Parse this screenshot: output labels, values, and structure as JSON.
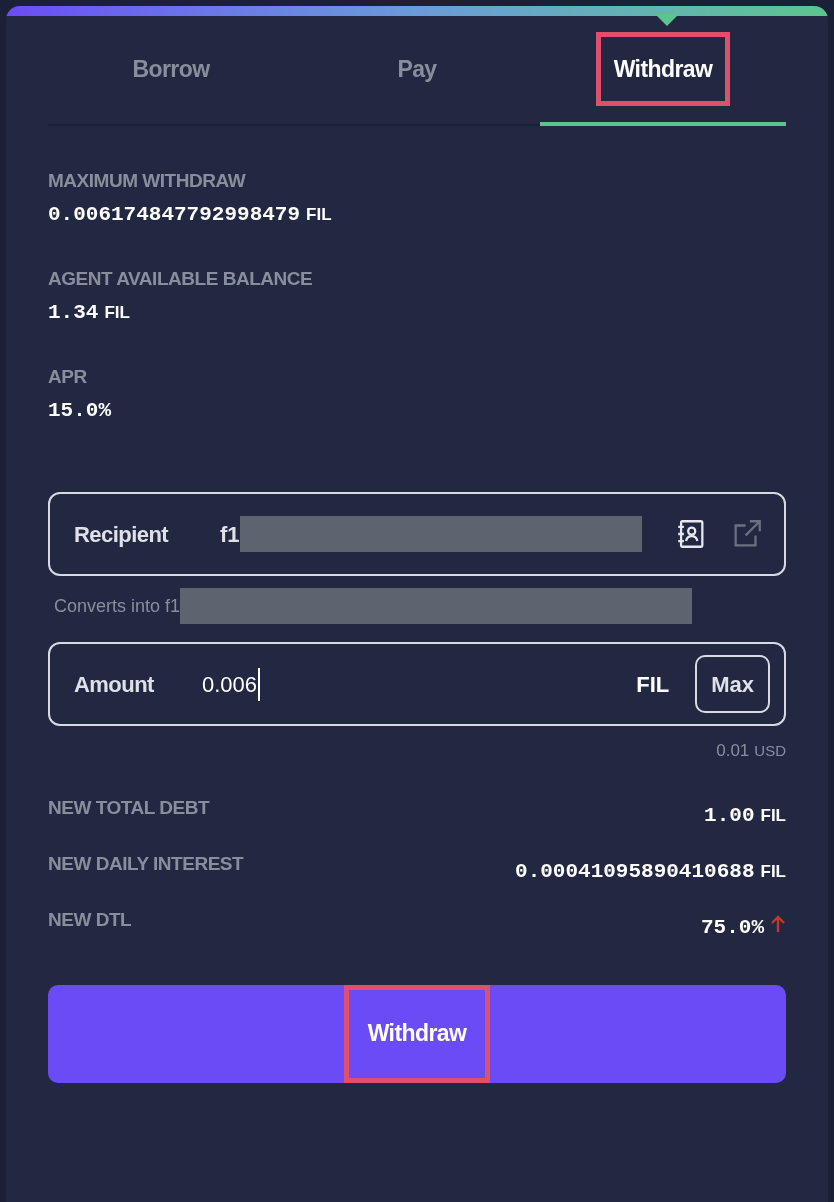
{
  "tabs": [
    {
      "label": "Borrow",
      "selected": false,
      "highlighted": false
    },
    {
      "label": "Pay",
      "selected": false,
      "highlighted": false
    },
    {
      "label": "Withdraw",
      "selected": true,
      "highlighted": true
    }
  ],
  "stats": [
    {
      "label": "MAXIMUM WITHDRAW",
      "value": "0.006174847792998479",
      "unit": "FIL"
    },
    {
      "label": "AGENT AVAILABLE BALANCE",
      "value": "1.34",
      "unit": "FIL"
    },
    {
      "label": "APR",
      "value": "15.0%"
    }
  ],
  "recipient": {
    "label": "Recipient",
    "value": "f1",
    "redacted": true,
    "hint": "Converts into f1",
    "hint_redacted": true
  },
  "amount": {
    "label": "Amount",
    "value": "0.006",
    "unit": "FIL",
    "max_button": "Max",
    "usd_value": "0.01",
    "usd_unit": "USD"
  },
  "summary": [
    {
      "label": "NEW TOTAL DEBT",
      "value": "1.00",
      "unit": "FIL",
      "rising": false
    },
    {
      "label": "NEW DAILY INTEREST",
      "value": "0.00041095890410688",
      "unit": "FIL",
      "rising": false
    },
    {
      "label": "NEW DTL",
      "value": "75.0%",
      "rising": true
    }
  ],
  "submit": {
    "label": "Withdraw",
    "highlighted": true
  }
}
